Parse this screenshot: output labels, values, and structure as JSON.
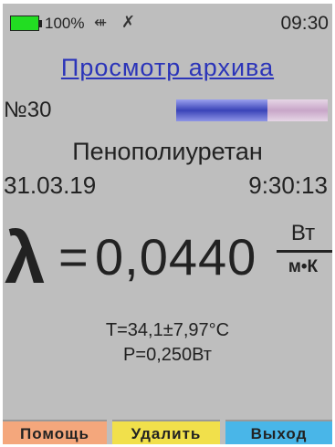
{
  "statusbar": {
    "battery_percent": "100%",
    "battery_level": 1.0,
    "battery_color": "#22dd22",
    "usb_icon": "⇺",
    "bluetooth_icon": "✗",
    "time": "09:30"
  },
  "title": "Просмотр архива",
  "record_number": "№30",
  "progress_fraction": 0.6,
  "material": "Пенополиуретан",
  "date": "31.03.19",
  "clock": "9:30:13",
  "measurement": {
    "symbol": "λ",
    "equals": "=",
    "value": "0,0440",
    "unit_numerator": "Вт",
    "unit_denominator": "м•К"
  },
  "temperature": "T=34,1±7,97°C",
  "power": "P=0,250Вт",
  "softkeys": {
    "help": "Помощь",
    "delete": "Удалить",
    "exit": "Выход"
  },
  "colors": {
    "title": "#2b34b9",
    "screen_bg": "#bebebe",
    "help_key": "#f4a77c",
    "delete_key": "#f1e04b",
    "exit_key": "#49b6e8"
  }
}
